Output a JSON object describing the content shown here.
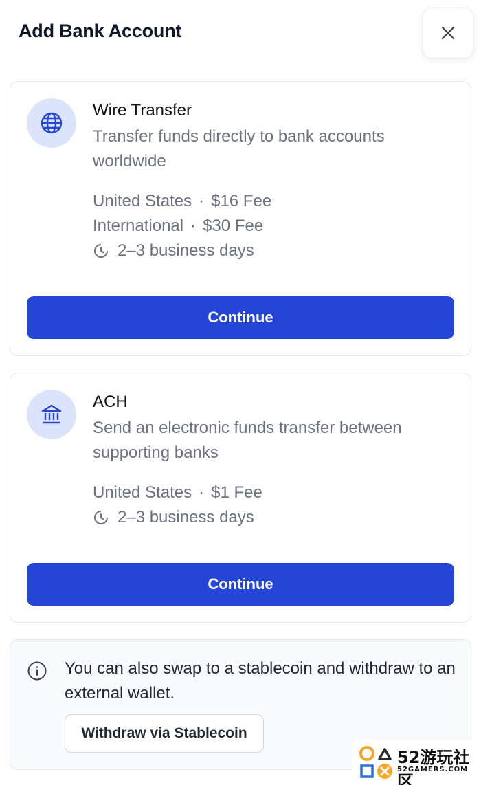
{
  "header": {
    "title": "Add Bank Account",
    "close_icon": "close-icon"
  },
  "colors": {
    "accent": "#2445d6",
    "icon_bg": "#dbe4fb",
    "muted_text": "#6b7280"
  },
  "options": [
    {
      "icon": "globe-icon",
      "title": "Wire Transfer",
      "description": "Transfer funds directly to bank accounts worldwide",
      "fees": [
        {
          "region": "United States",
          "separator": "·",
          "fee": "$16 Fee"
        },
        {
          "region": "International",
          "separator": "·",
          "fee": "$30 Fee"
        }
      ],
      "timing_icon": "clock-icon",
      "timing": "2–3 business days",
      "button_label": "Continue"
    },
    {
      "icon": "bank-icon",
      "title": "ACH",
      "description": "Send an electronic funds transfer between supporting banks",
      "fees": [
        {
          "region": "United States",
          "separator": "·",
          "fee": "$1 Fee"
        }
      ],
      "timing_icon": "clock-icon",
      "timing": "2–3 business days",
      "button_label": "Continue"
    }
  ],
  "info": {
    "icon": "info-icon",
    "text": "You can also swap to a stablecoin and withdraw to an external wallet.",
    "button_label": "Withdraw via Stablecoin"
  },
  "watermark": {
    "text": "52游玩社区",
    "subtext": "52GAMERS.COM"
  }
}
